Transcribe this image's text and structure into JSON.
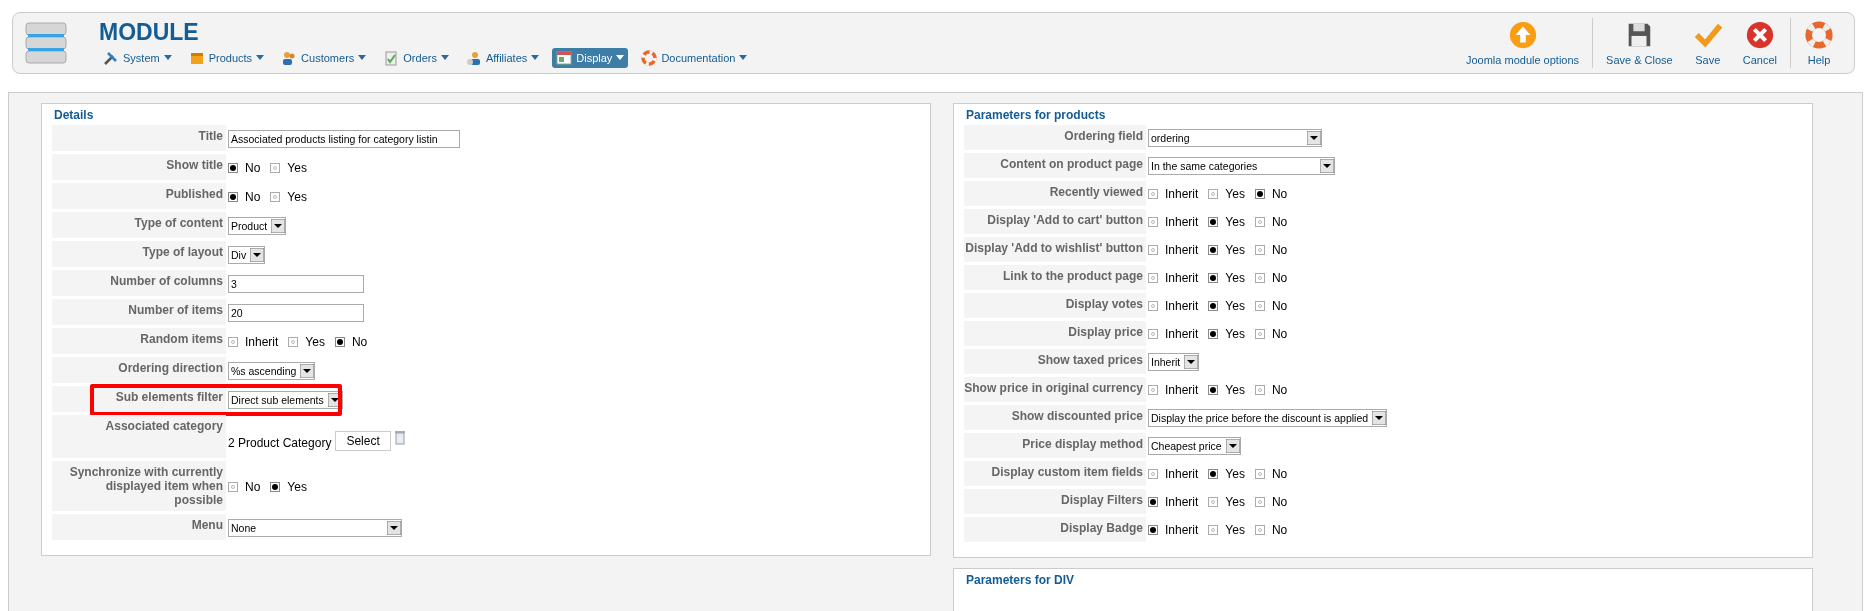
{
  "header": {
    "title": "MODULE",
    "menu": [
      {
        "label": "System",
        "selected": false
      },
      {
        "label": "Products",
        "selected": false
      },
      {
        "label": "Customers",
        "selected": false
      },
      {
        "label": "Orders",
        "selected": false
      },
      {
        "label": "Affiliates",
        "selected": false
      },
      {
        "label": "Display",
        "selected": true
      },
      {
        "label": "Documentation",
        "selected": false
      }
    ],
    "toolbar": [
      {
        "label": "Joomla module options"
      },
      {
        "label": "Save & Close"
      },
      {
        "label": "Save"
      },
      {
        "label": "Cancel"
      },
      {
        "label": "Help"
      }
    ]
  },
  "details": {
    "legend": "Details",
    "rows": [
      {
        "label": "Title",
        "kind": "text",
        "value": "Associated products listing for category listin"
      },
      {
        "label": "Show title",
        "kind": "radio",
        "options": [
          {
            "label": "No",
            "selected": true
          },
          {
            "label": "Yes",
            "selected": false
          }
        ]
      },
      {
        "label": "Published",
        "kind": "radio",
        "options": [
          {
            "label": "No",
            "selected": true
          },
          {
            "label": "Yes",
            "selected": false
          }
        ]
      },
      {
        "label": "Type of content",
        "kind": "select",
        "value": "Product"
      },
      {
        "label": "Type of layout",
        "kind": "select",
        "value": "Div"
      },
      {
        "label": "Number of columns",
        "kind": "text",
        "value": "3"
      },
      {
        "label": "Number of items",
        "kind": "text",
        "value": "20"
      },
      {
        "label": "Random items",
        "kind": "radio",
        "options": [
          {
            "label": "Inherit",
            "selected": false
          },
          {
            "label": "Yes",
            "selected": false
          },
          {
            "label": "No",
            "selected": true
          }
        ]
      },
      {
        "label": "Ordering direction",
        "kind": "select",
        "value": "%s ascending"
      },
      {
        "label": "Sub elements filter",
        "kind": "select",
        "value": "Direct sub elements",
        "highlighted": true
      },
      {
        "label": "Associated category",
        "kind": "category",
        "value": "2 Product Category",
        "button": "Select"
      },
      {
        "label": "Synchronize with currently displayed item when possible",
        "kind": "radio",
        "options": [
          {
            "label": "No",
            "selected": false
          },
          {
            "label": "Yes",
            "selected": true
          }
        ]
      },
      {
        "label": "Menu",
        "kind": "select",
        "value": "None"
      }
    ]
  },
  "products": {
    "legend": "Parameters for products",
    "rows": [
      {
        "label": "Ordering field",
        "kind": "select",
        "value": "ordering"
      },
      {
        "label": "Content on product page",
        "kind": "select",
        "value": "In the same categories"
      },
      {
        "label": "Recently viewed",
        "kind": "radio",
        "options": [
          {
            "label": "Inherit",
            "selected": false
          },
          {
            "label": "Yes",
            "selected": false
          },
          {
            "label": "No",
            "selected": true
          }
        ]
      },
      {
        "label": "Display 'Add to cart' button",
        "kind": "radio",
        "options": [
          {
            "label": "Inherit",
            "selected": false
          },
          {
            "label": "Yes",
            "selected": true
          },
          {
            "label": "No",
            "selected": false
          }
        ]
      },
      {
        "label": "Display 'Add to wishlist' button",
        "kind": "radio",
        "options": [
          {
            "label": "Inherit",
            "selected": false
          },
          {
            "label": "Yes",
            "selected": true
          },
          {
            "label": "No",
            "selected": false
          }
        ]
      },
      {
        "label": "Link to the product page",
        "kind": "radio",
        "options": [
          {
            "label": "Inherit",
            "selected": false
          },
          {
            "label": "Yes",
            "selected": true
          },
          {
            "label": "No",
            "selected": false
          }
        ]
      },
      {
        "label": "Display votes",
        "kind": "radio",
        "options": [
          {
            "label": "Inherit",
            "selected": false
          },
          {
            "label": "Yes",
            "selected": true
          },
          {
            "label": "No",
            "selected": false
          }
        ]
      },
      {
        "label": "Display price",
        "kind": "radio",
        "options": [
          {
            "label": "Inherit",
            "selected": false
          },
          {
            "label": "Yes",
            "selected": true
          },
          {
            "label": "No",
            "selected": false
          }
        ]
      },
      {
        "label": "Show taxed prices",
        "kind": "select",
        "value": "Inherit"
      },
      {
        "label": "Show price in original currency",
        "kind": "radio",
        "options": [
          {
            "label": "Inherit",
            "selected": false
          },
          {
            "label": "Yes",
            "selected": true
          },
          {
            "label": "No",
            "selected": false
          }
        ]
      },
      {
        "label": "Show discounted price",
        "kind": "select",
        "value": "Display the price before the discount is applied"
      },
      {
        "label": "Price display method",
        "kind": "select",
        "value": "Cheapest price"
      },
      {
        "label": "Display custom item fields",
        "kind": "radio",
        "options": [
          {
            "label": "Inherit",
            "selected": false
          },
          {
            "label": "Yes",
            "selected": true
          },
          {
            "label": "No",
            "selected": false
          }
        ]
      },
      {
        "label": "Display Filters",
        "kind": "radio",
        "options": [
          {
            "label": "Inherit",
            "selected": true
          },
          {
            "label": "Yes",
            "selected": false
          },
          {
            "label": "No",
            "selected": false
          }
        ]
      },
      {
        "label": "Display Badge",
        "kind": "radio",
        "options": [
          {
            "label": "Inherit",
            "selected": true
          },
          {
            "label": "Yes",
            "selected": false
          },
          {
            "label": "No",
            "selected": false
          }
        ]
      }
    ]
  },
  "div_params": {
    "legend": "Parameters for DIV"
  }
}
